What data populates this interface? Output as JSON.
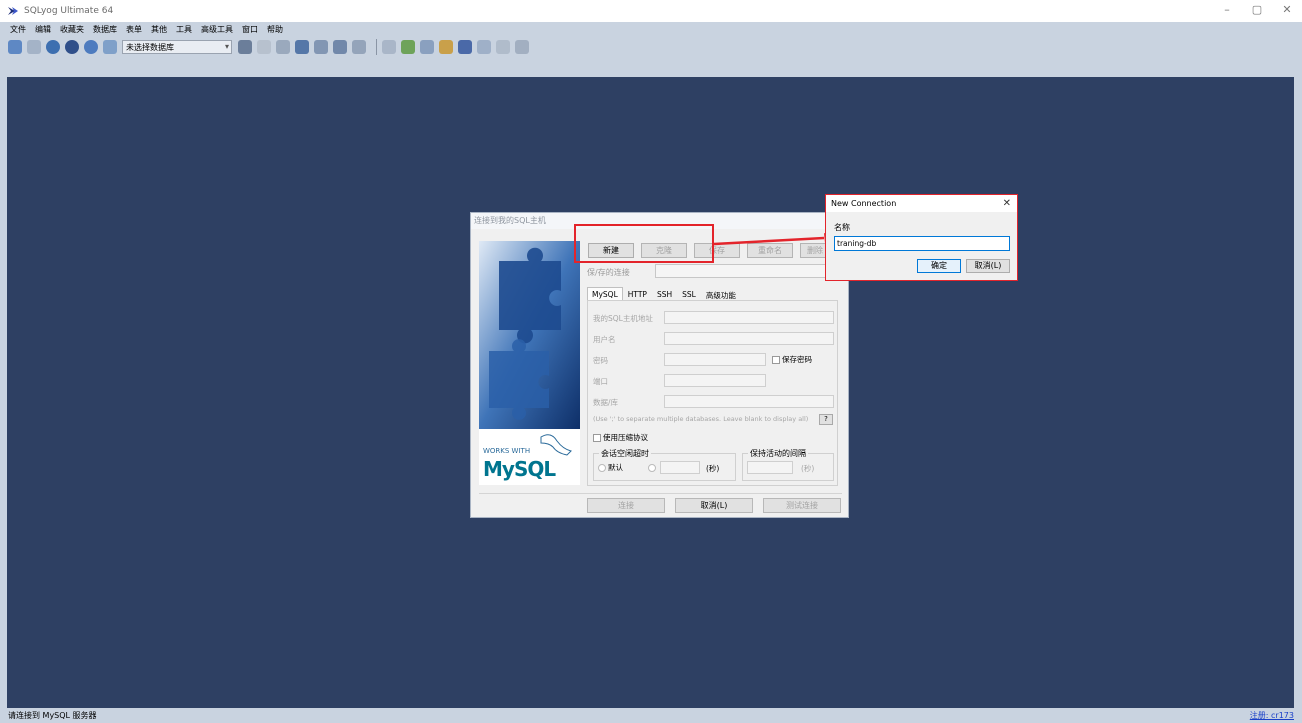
{
  "window": {
    "title": "SQLyog Ultimate 64",
    "controls": [
      "–",
      "▢",
      "✕"
    ]
  },
  "menu": [
    "文件",
    "编辑",
    "收藏夹",
    "数据库",
    "表单",
    "其他",
    "工具",
    "高级工具",
    "窗口",
    "帮助"
  ],
  "toolbar": {
    "db_select": "未选择数据库"
  },
  "status": {
    "left": "请连接到 MySQL 服务器",
    "right": "注册: cr173"
  },
  "connect_dialog": {
    "title": "连接到我的SQL主机",
    "buttons": {
      "new": "新建",
      "clone": "克隆",
      "save": "保存",
      "rename": "重命名",
      "delete": "删除"
    },
    "saved_connection_label": "保/存的连接",
    "tabs": [
      "MySQL",
      "HTTP",
      "SSH",
      "SSL",
      "高级功能"
    ],
    "fields": {
      "host": "我的SQL主机地址",
      "user": "用户名",
      "password": "密码",
      "save_password": "保存密码",
      "port": "端口",
      "database": "数据/库",
      "db_hint": "(Use ';' to separate multiple databases. Leave blank to display all)",
      "help": "?",
      "compress": "使用压缩协议",
      "session_timeout": "会话空闲超时",
      "default": "默认",
      "seconds": "(秒)",
      "keepalive": "保持活动的间隔"
    },
    "footer": {
      "connect": "连接",
      "cancel": "取消(L)",
      "test": "测试连接"
    },
    "logo": {
      "works_with": "WORKS WITH",
      "brand": "MySQL"
    }
  },
  "new_connection": {
    "title": "New Connection",
    "name_label": "名称",
    "name_value": "traning-db",
    "ok": "确定",
    "cancel": "取消(L)"
  },
  "colors": {
    "workspace": "#2e4063",
    "chrome": "#c9d3e0",
    "highlight": "#e3242b"
  }
}
